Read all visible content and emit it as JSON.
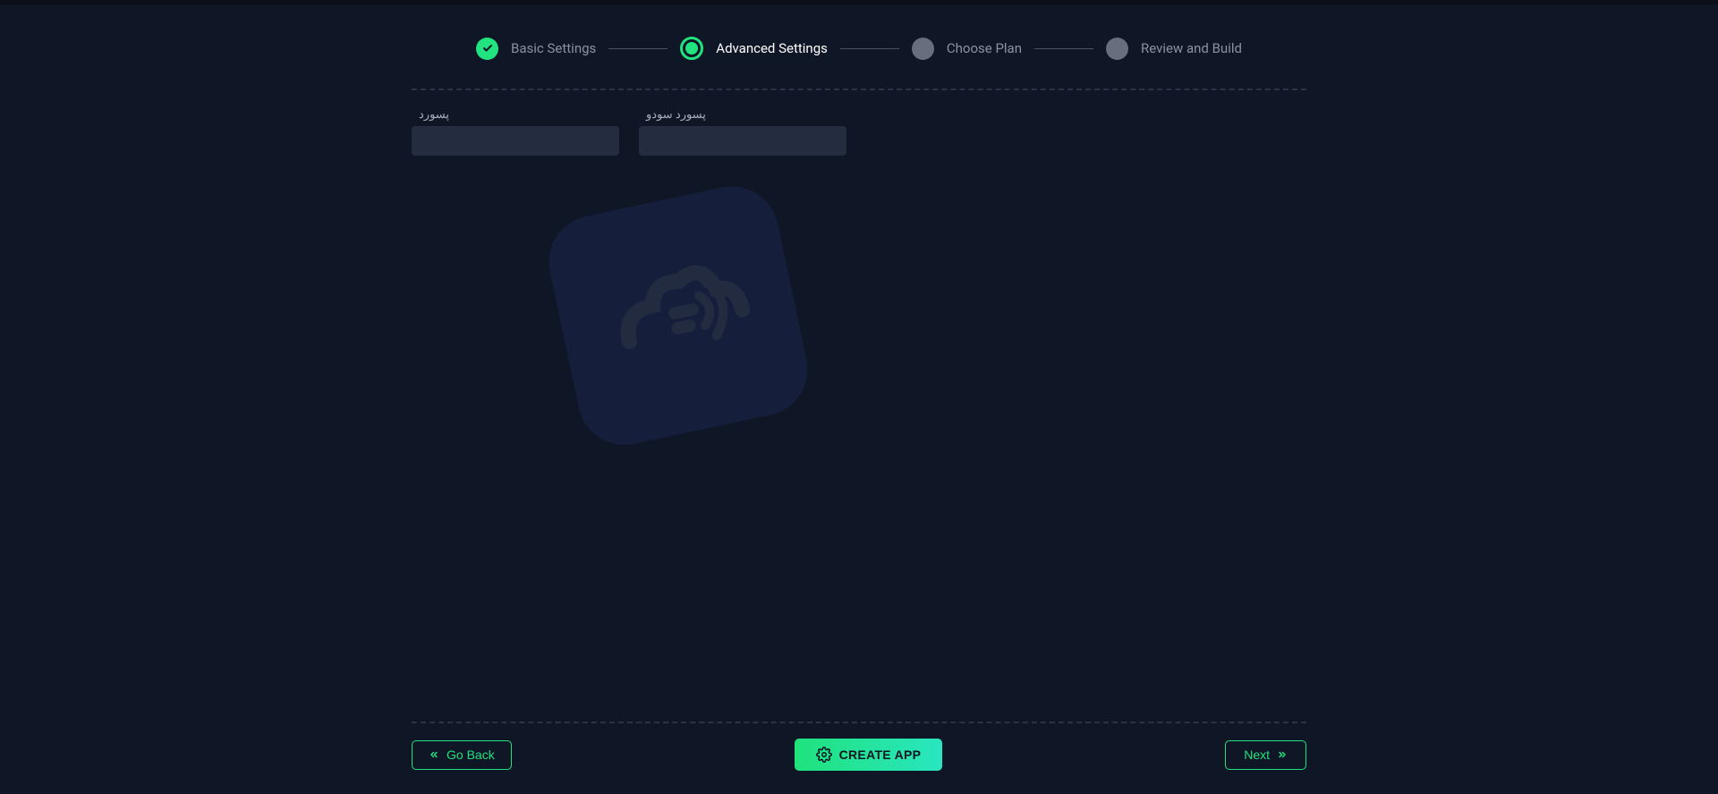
{
  "stepper": {
    "steps": [
      {
        "label": "Basic Settings",
        "state": "completed"
      },
      {
        "label": "Advanced Settings",
        "state": "active"
      },
      {
        "label": "Choose Plan",
        "state": "upcoming"
      },
      {
        "label": "Review and Build",
        "state": "upcoming"
      }
    ]
  },
  "form": {
    "password": {
      "label": "پسورد",
      "value": ""
    },
    "sudo_password": {
      "label": "پسورد سودو",
      "value": ""
    }
  },
  "footer": {
    "go_back_label": "Go Back",
    "create_app_label": "CREATE APP",
    "next_label": "Next"
  }
}
